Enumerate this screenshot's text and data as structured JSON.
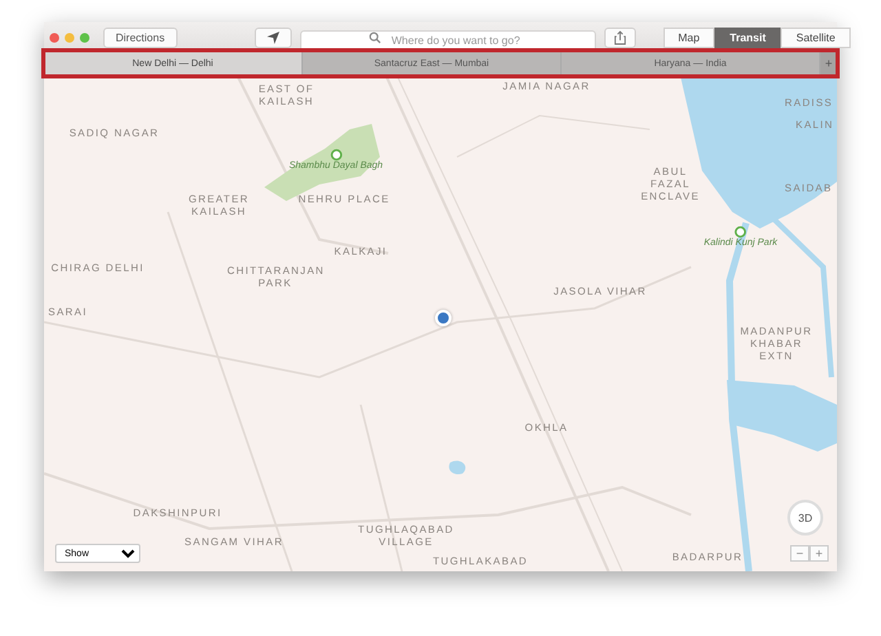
{
  "toolbar": {
    "directions_button": "Directions",
    "search": {
      "placeholder": "Where do you want to go?"
    },
    "view_modes": [
      {
        "label": "Map",
        "selected": false
      },
      {
        "label": "Transit",
        "selected": true
      },
      {
        "label": "Satellite",
        "selected": false
      }
    ]
  },
  "tabs": [
    {
      "label": "New Delhi — Delhi",
      "selected": true
    },
    {
      "label": "Santacruz East — Mumbai",
      "selected": false
    },
    {
      "label": "Haryana — India",
      "selected": false
    }
  ],
  "new_tab_button": "+",
  "map": {
    "places": [
      {
        "name": "EAST OF KAILASH",
        "kind": "area"
      },
      {
        "name": "JAMIA NAGAR",
        "kind": "area"
      },
      {
        "name": "SADIQ NAGAR",
        "kind": "area"
      },
      {
        "name": "Shambhu Dayal Bagh",
        "kind": "park"
      },
      {
        "name": "GREATER KAILASH",
        "kind": "area"
      },
      {
        "name": "NEHRU PLACE",
        "kind": "area"
      },
      {
        "name": "KALKAJI",
        "kind": "area"
      },
      {
        "name": "CHIRAG DELHI",
        "kind": "area"
      },
      {
        "name": "CHITTARANJAN PARK",
        "kind": "area"
      },
      {
        "name": "SARAI",
        "kind": "area"
      },
      {
        "name": "RADISS",
        "kind": "area"
      },
      {
        "name": "KALIN",
        "kind": "area"
      },
      {
        "name": "ABUL FAZAL ENCLAVE",
        "kind": "area"
      },
      {
        "name": "SAIDAB",
        "kind": "area"
      },
      {
        "name": "Kalindi Kunj Park",
        "kind": "park"
      },
      {
        "name": "JASOLA VIHAR",
        "kind": "area"
      },
      {
        "name": "MADANPUR KHABAR EXTN",
        "kind": "area"
      },
      {
        "name": "OKHLA",
        "kind": "area"
      },
      {
        "name": "DAKSHINPURI",
        "kind": "area"
      },
      {
        "name": "SANGAM VIHAR",
        "kind": "area"
      },
      {
        "name": "TUGHLAQABAD VILLAGE",
        "kind": "area"
      },
      {
        "name": "TUGHLAKABAD",
        "kind": "area"
      },
      {
        "name": "BADARPUR",
        "kind": "area"
      }
    ],
    "show_menu": "Show",
    "view_3d_button": "3D",
    "zoom_out": "−",
    "zoom_in": "+"
  }
}
